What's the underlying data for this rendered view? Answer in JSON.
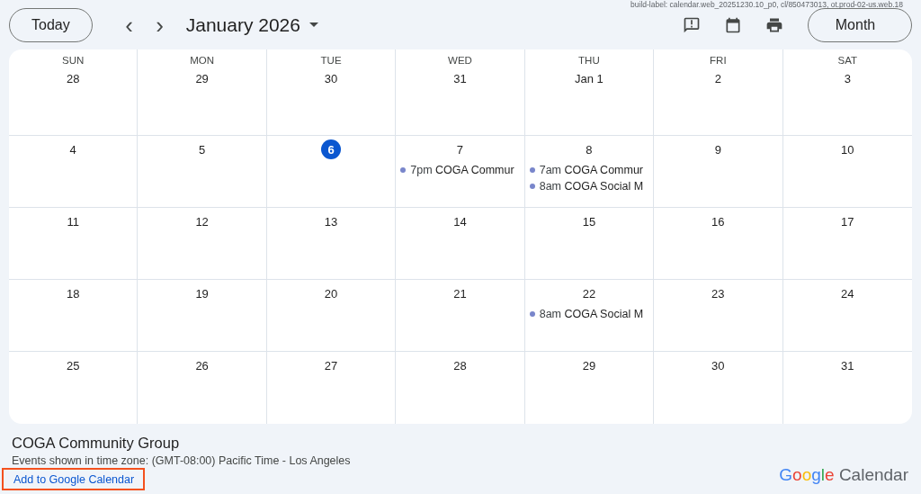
{
  "build_label": "build-label: calendar.web_20251230.10_p0, cl/850473013, ot.prod-02-us.web.18",
  "toolbar": {
    "today_button": "Today",
    "prev": "‹",
    "next": "›",
    "month_title": "January 2026",
    "view_button": "Month"
  },
  "weekdays": [
    "SUN",
    "MON",
    "TUE",
    "WED",
    "THU",
    "FRI",
    "SAT"
  ],
  "weeks": [
    [
      {
        "date": "28",
        "today": false
      },
      {
        "date": "29",
        "today": false
      },
      {
        "date": "30",
        "today": false
      },
      {
        "date": "31",
        "today": false
      },
      {
        "date": "Jan 1",
        "today": false
      },
      {
        "date": "2",
        "today": false
      },
      {
        "date": "3",
        "today": false
      }
    ],
    [
      {
        "date": "4",
        "today": false
      },
      {
        "date": "5",
        "today": false
      },
      {
        "date": "6",
        "today": true
      },
      {
        "date": "7",
        "today": false,
        "events": [
          {
            "time": "7pm",
            "title": "COGA Commur",
            "color": "#7986cb"
          }
        ]
      },
      {
        "date": "8",
        "today": false,
        "events": [
          {
            "time": "7am",
            "title": "COGA Commur",
            "color": "#7986cb"
          },
          {
            "time": "8am",
            "title": "COGA Social M",
            "color": "#7986cb"
          }
        ]
      },
      {
        "date": "9",
        "today": false
      },
      {
        "date": "10",
        "today": false
      }
    ],
    [
      {
        "date": "11",
        "today": false
      },
      {
        "date": "12",
        "today": false
      },
      {
        "date": "13",
        "today": false
      },
      {
        "date": "14",
        "today": false
      },
      {
        "date": "15",
        "today": false
      },
      {
        "date": "16",
        "today": false
      },
      {
        "date": "17",
        "today": false
      }
    ],
    [
      {
        "date": "18",
        "today": false
      },
      {
        "date": "19",
        "today": false
      },
      {
        "date": "20",
        "today": false
      },
      {
        "date": "21",
        "today": false
      },
      {
        "date": "22",
        "today": false,
        "events": [
          {
            "time": "8am",
            "title": "COGA Social M",
            "color": "#7986cb"
          }
        ]
      },
      {
        "date": "23",
        "today": false
      },
      {
        "date": "24",
        "today": false
      }
    ],
    [
      {
        "date": "25",
        "today": false
      },
      {
        "date": "26",
        "today": false
      },
      {
        "date": "27",
        "today": false
      },
      {
        "date": "28",
        "today": false
      },
      {
        "date": "29",
        "today": false
      },
      {
        "date": "30",
        "today": false
      },
      {
        "date": "31",
        "today": false
      }
    ]
  ],
  "footer": {
    "calendar_name": "COGA Community Group",
    "timezone_note": "Events shown in time zone: (GMT-08:00) Pacific Time - Los Angeles",
    "add_link": {
      "label": "Add to Google Calendar",
      "highlighted": true
    },
    "logo_word": "Google",
    "logo_product": "Calendar"
  }
}
